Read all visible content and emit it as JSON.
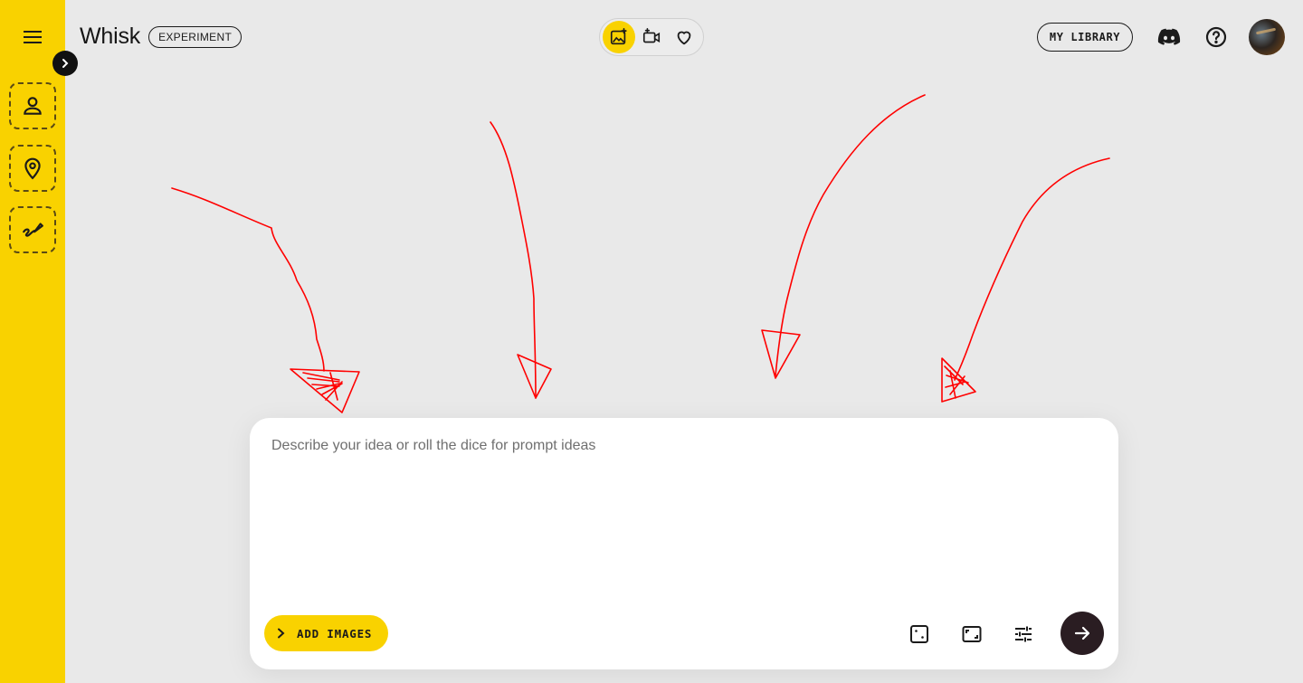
{
  "app": {
    "title": "Whisk",
    "badge": "EXPERIMENT"
  },
  "sidebar": {
    "menu_icon": "hamburger-menu-icon",
    "expand_icon": "chevron-right-icon",
    "slots": [
      {
        "icon": "person-icon",
        "kind": "subject"
      },
      {
        "icon": "location-pin-icon",
        "kind": "scene"
      },
      {
        "icon": "brush-stroke-icon",
        "kind": "style"
      }
    ]
  },
  "header": {
    "modes": [
      {
        "icon": "image-sparkle-icon",
        "active": true
      },
      {
        "icon": "video-sparkle-icon",
        "active": false
      },
      {
        "icon": "heart-icon",
        "active": false
      }
    ],
    "library_label": "MY LIBRARY",
    "discord_icon": "discord-icon",
    "help_icon": "help-circle-icon",
    "avatar_icon": "user-avatar"
  },
  "prompt": {
    "placeholder": "Describe your idea or roll the dice for prompt ideas",
    "value": "",
    "add_images_label": "ADD IMAGES",
    "tools": [
      "dice-icon",
      "aspect-ratio-icon",
      "settings-sliders-icon"
    ],
    "send_icon": "arrow-right-icon"
  },
  "annotation": {
    "color": "#ff0000",
    "arrow_count": 4
  },
  "colors": {
    "accent": "#f9d200",
    "background": "#e9e9e9",
    "card": "#ffffff",
    "send": "#2a1d22"
  }
}
